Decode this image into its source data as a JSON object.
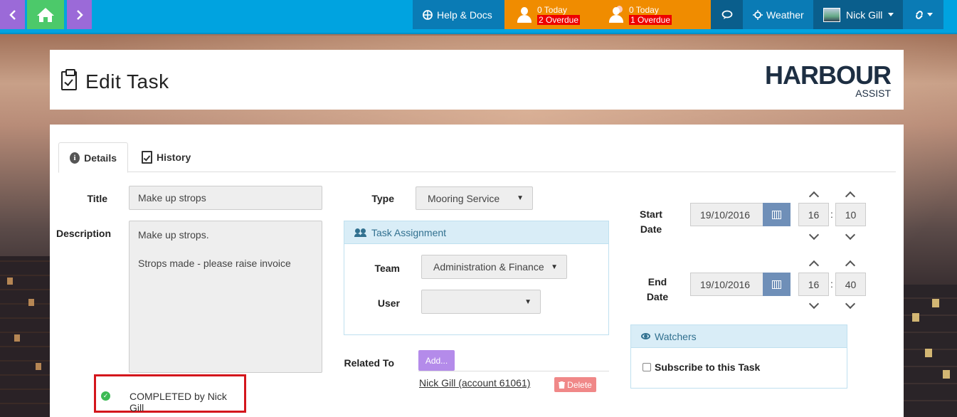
{
  "nav": {
    "help_label": "Help & Docs",
    "alert1": {
      "today": "0 Today",
      "overdue": "2 Overdue"
    },
    "alert2": {
      "today": "0 Today",
      "overdue": "1 Overdue"
    },
    "weather_label": "Weather",
    "user_name": "Nick Gill"
  },
  "header": {
    "title": "Edit Task",
    "logo_main": "HARBOUR",
    "logo_sub": "ASSIST"
  },
  "tabs": [
    {
      "label": "Details",
      "active": true
    },
    {
      "label": "History",
      "active": false
    }
  ],
  "form": {
    "title_label": "Title",
    "title_value": "Make up strops",
    "description_label": "Description",
    "description_line1": "Make up strops.",
    "description_line2": "Strops made - please raise invoice",
    "completed_text": "COMPLETED by Nick Gill",
    "type_label": "Type",
    "type_value": "Mooring Service",
    "assignment_title": "Task Assignment",
    "team_label": "Team",
    "team_value": "Administration & Finance",
    "user_label": "User",
    "user_value": "",
    "related_label": "Related To",
    "add_label": "Add...",
    "related_link": "Nick Gill (account 61061)",
    "delete_label": "Delete",
    "start_label_1": "Start",
    "start_label_2": "Date",
    "start_date": "19/10/2016",
    "start_hour": "16",
    "start_min": "10",
    "end_label_1": "End",
    "end_label_2": "Date",
    "end_date": "19/10/2016",
    "end_hour": "16",
    "end_min": "40",
    "watchers_title": "Watchers",
    "subscribe_label": "Subscribe to this Task"
  },
  "colors": {
    "topbar": "#00a3e0",
    "alerts": "#f08c00",
    "completed_border": "#d4161c",
    "panel_head": "#d9edf7"
  }
}
